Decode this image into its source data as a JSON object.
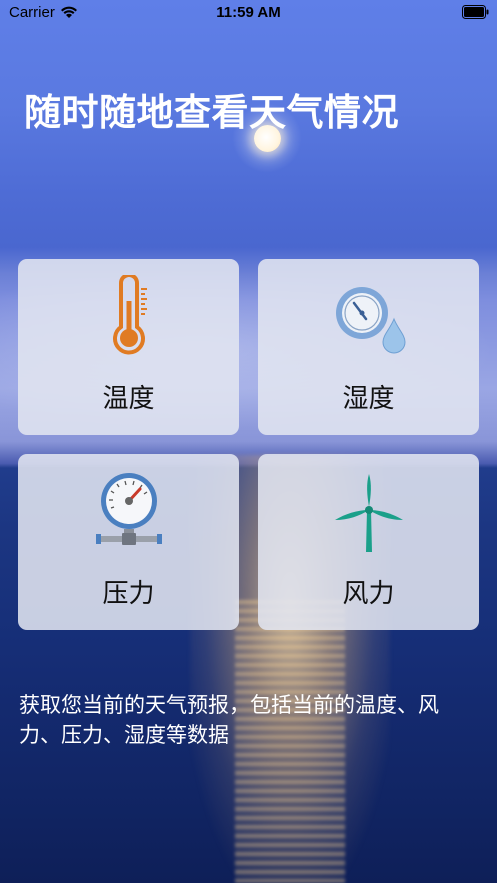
{
  "status_bar": {
    "carrier": "Carrier",
    "time": "11:59 AM"
  },
  "headline": "随时随地查看天气情况",
  "cards": [
    {
      "label": "温度",
      "icon": "thermometer-icon"
    },
    {
      "label": "湿度",
      "icon": "hygrometer-icon"
    },
    {
      "label": "压力",
      "icon": "pressure-gauge-icon"
    },
    {
      "label": "风力",
      "icon": "wind-turbine-icon"
    }
  ],
  "description": "获取您当前的天气预报，包括当前的温度、风力、压力、湿度等数据",
  "colors": {
    "thermometer": "#e07b23",
    "gauge_ring": "#4a7fc0",
    "turbine": "#1aa08a",
    "card_bg": "#e1e5f0"
  }
}
